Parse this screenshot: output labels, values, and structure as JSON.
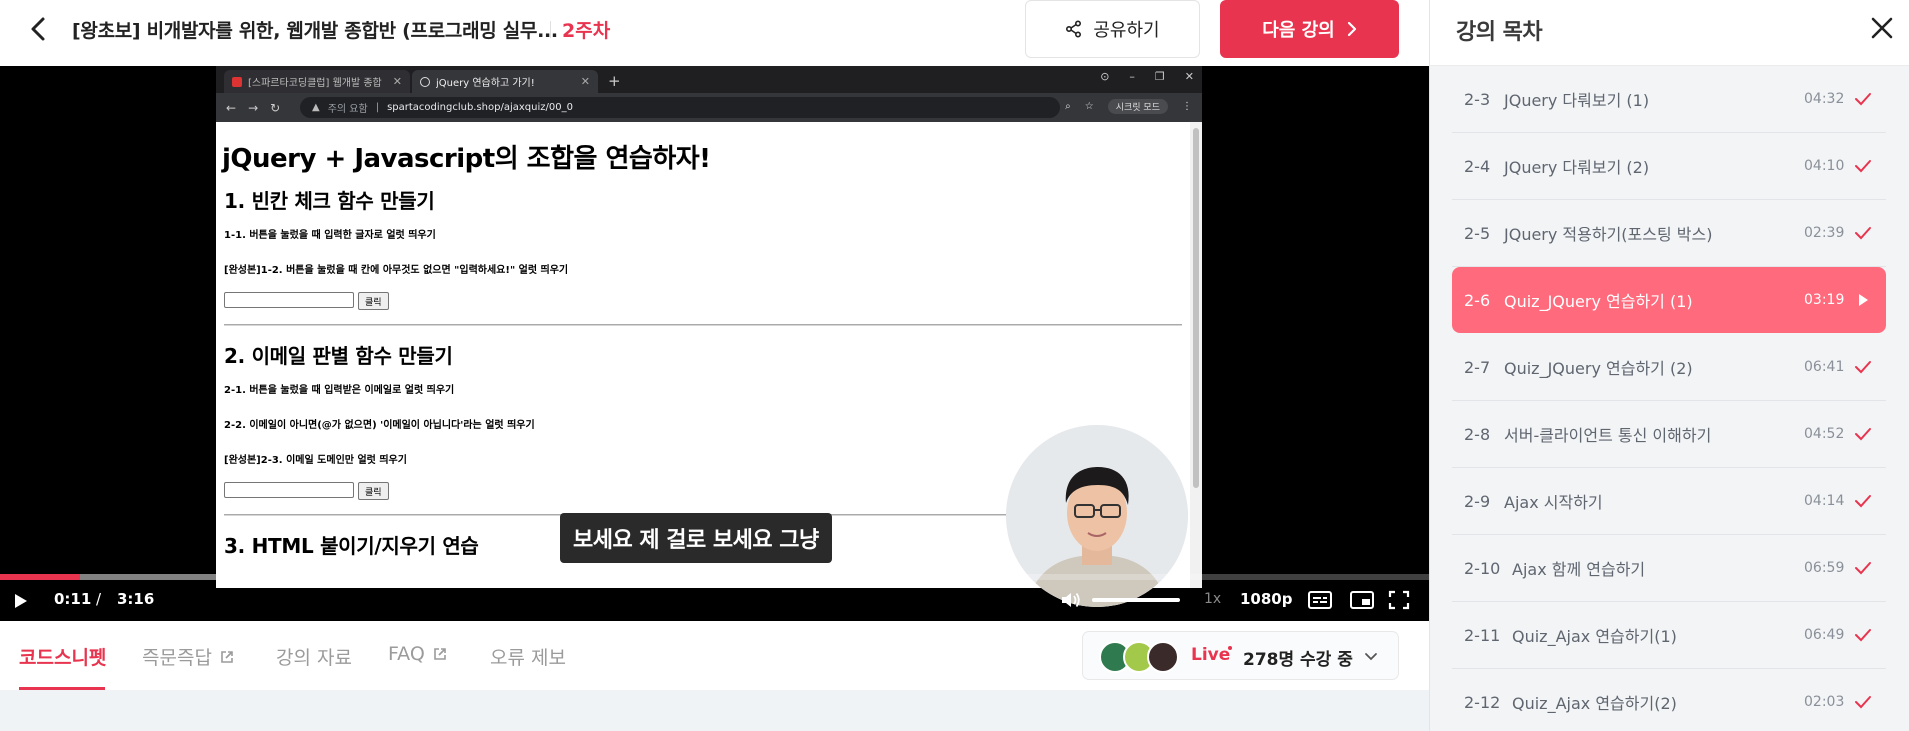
{
  "header": {
    "title": "[왕초보] 비개발자를 위한, 웹개발 종합반 (프로그래밍 실무...",
    "week": "2주차",
    "share_label": "공유하기",
    "next_label": "다음 강의"
  },
  "browser": {
    "tabs": [
      {
        "label": "[스파르타코딩클럽] 웹개발 종합"
      },
      {
        "label": "jQuery 연습하고 가기!"
      }
    ],
    "address_warning": "주의 요함",
    "url": "spartacodingclub.shop/ajaxquiz/00_0",
    "profile": "시크릿 모드"
  },
  "video_page": {
    "h1": "jQuery + Javascript의 조합을 연습하자!",
    "section1_title": "1. 빈칸 체크 함수 만들기",
    "s1_item1": "1-1. 버튼을 눌렀을 때 입력한 글자로 얼럿 띄우기",
    "s1_item2": "[완성본]1-2. 버튼을 눌렀을 때 칸에 아무것도 없으면 \"입력하세요!\" 얼럿 띄우기",
    "button_label": "클릭",
    "section2_title": "2. 이메일 판별 함수 만들기",
    "s2_item1": "2-1. 버튼을 눌렀을 때 입력받은 이메일로 얼럿 띄우기",
    "s2_item2": "2-2. 이메일이 아니면(@가 없으면) '이메일이 아닙니다'라는 얼럿 띄우기",
    "s2_item3": "[완성본]2-3. 이메일 도메인만 얼럿 띄우기",
    "section3_title": "3. HTML 붙이기/지우기 연습"
  },
  "player": {
    "subtitle": "보세요 제 걸로 보세요 그냥",
    "current_time": "0:11",
    "separator": "/",
    "duration": "3:16",
    "played_fraction": 0.056,
    "speed": "1x",
    "quality": "1080p"
  },
  "bottom_tabs": [
    {
      "label": "코드스니펫"
    },
    {
      "label": "즉문즉답"
    },
    {
      "label": "강의 자료"
    },
    {
      "label": "FAQ"
    },
    {
      "label": "오류 제보"
    }
  ],
  "live": {
    "label": "Live",
    "count": "278명 수강 중"
  },
  "sidebar": {
    "title": "강의 목차",
    "lessons": [
      {
        "num": "2-3",
        "name": "JQuery 다뤄보기 (1)",
        "duration": "04:32",
        "status": "done"
      },
      {
        "num": "2-4",
        "name": "JQuery 다뤄보기 (2)",
        "duration": "04:10",
        "status": "done"
      },
      {
        "num": "2-5",
        "name": "JQuery 적용하기(포스팅 박스)",
        "duration": "02:39",
        "status": "done"
      },
      {
        "num": "2-6",
        "name": "Quiz_JQuery 연습하기 (1)",
        "duration": "03:19",
        "status": "playing"
      },
      {
        "num": "2-7",
        "name": "Quiz_JQuery 연습하기 (2)",
        "duration": "06:41",
        "status": "done"
      },
      {
        "num": "2-8",
        "name": "서버-클라이언트 통신 이해하기",
        "duration": "04:52",
        "status": "done"
      },
      {
        "num": "2-9",
        "name": "Ajax 시작하기",
        "duration": "04:14",
        "status": "done"
      },
      {
        "num": "2-10",
        "name": "Ajax 함께 연습하기",
        "duration": "06:59",
        "status": "done"
      },
      {
        "num": "2-11",
        "name": "Quiz_Ajax 연습하기(1)",
        "duration": "06:49",
        "status": "done"
      },
      {
        "num": "2-12",
        "name": "Quiz_Ajax 연습하기(2)",
        "duration": "02:03",
        "status": "done"
      }
    ]
  },
  "colors": {
    "accent": "#e8344e",
    "active_lesson": "#ff6b7d"
  }
}
